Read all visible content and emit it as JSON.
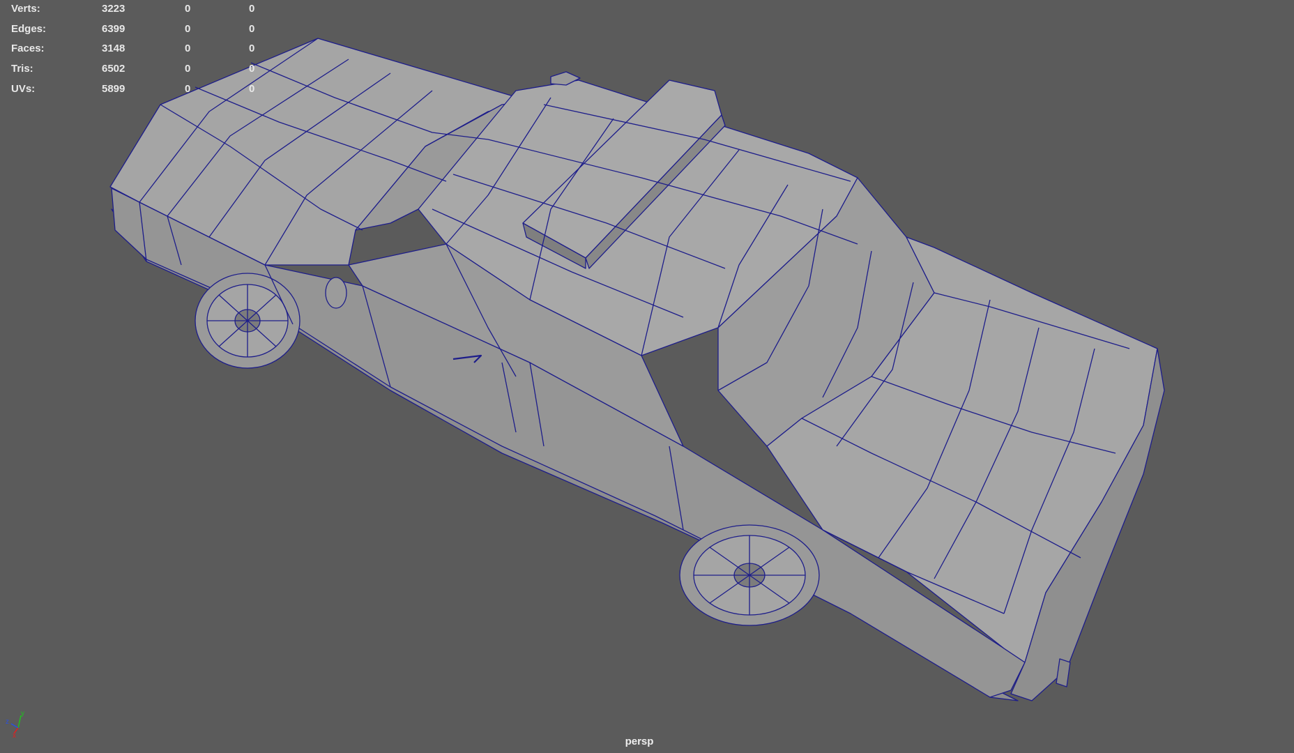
{
  "hud": {
    "rows": [
      {
        "label": "Verts:",
        "total": "3223",
        "selected": "0",
        "component": "0"
      },
      {
        "label": "Edges:",
        "total": "6399",
        "selected": "0",
        "component": "0"
      },
      {
        "label": "Faces:",
        "total": "3148",
        "selected": "0",
        "component": "0"
      },
      {
        "label": "Tris:",
        "total": "6502",
        "selected": "0",
        "component": "0"
      },
      {
        "label": "UVs:",
        "total": "5899",
        "selected": "0",
        "component": "0"
      }
    ]
  },
  "viewport": {
    "camera_name": "persp",
    "background_color": "#5b5b5b",
    "wire_color": "#1a1a8c",
    "shade_color": "#a3a3a3"
  },
  "axis_gizmo": {
    "labels": [
      "z",
      "y",
      "x"
    ],
    "colors": {
      "x": "#e02020",
      "y": "#20c020",
      "z": "#2a50e0"
    }
  },
  "model": {
    "object": "police-car"
  }
}
